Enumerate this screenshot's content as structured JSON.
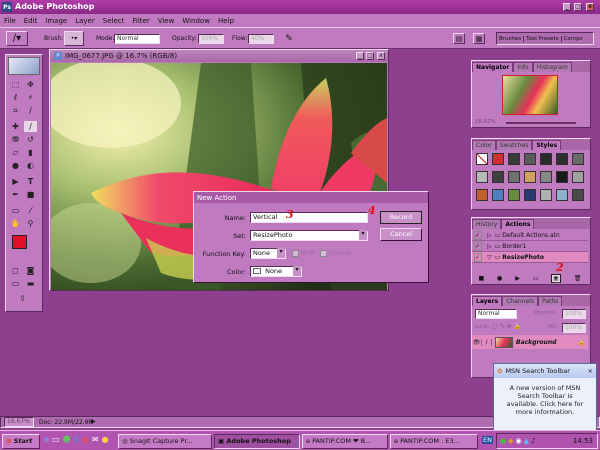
{
  "app": {
    "title": "Adobe Photoshop"
  },
  "menu": [
    "File",
    "Edit",
    "Image",
    "Layer",
    "Select",
    "Filter",
    "View",
    "Window",
    "Help"
  ],
  "options": {
    "brush_label": "Brush:",
    "mode_label": "Mode:",
    "mode_value": "Normal",
    "opacity_label": "Opacity:",
    "opacity_value": "100%",
    "flow_label": "Flow:",
    "flow_value": "40%",
    "well_tabs": [
      "Brushes",
      "Tool Presets",
      "Comps"
    ]
  },
  "document": {
    "title": "IMG_0677.JPG @ 16.7% (RGB/8)"
  },
  "dialog": {
    "title": "New Action",
    "name_label": "Name:",
    "name_value": "Vertical",
    "set_label": "Set:",
    "set_value": "ResizePhoto",
    "fkey_label": "Function Key:",
    "fkey_value": "None",
    "shift_label": "Shift",
    "control_label": "Control",
    "color_label": "Color:",
    "color_value": "None",
    "record_label": "Record",
    "cancel_label": "Cancel"
  },
  "annotations": {
    "n2": "2",
    "n3": "3",
    "n4": "4"
  },
  "navigator": {
    "tabs": [
      "Navigator",
      "Info",
      "Histogram"
    ],
    "zoom": "16.67%"
  },
  "swatches": {
    "tabs": [
      "Color",
      "Swatches",
      "Styles"
    ],
    "colors": [
      "#ffffff",
      "#d23030",
      "#3a3a3a",
      "#5a5a5a",
      "#2a2a2a",
      "#2e2e2e",
      "#6a6a6a",
      "#b8b8b8",
      "#404040",
      "#707070",
      "#d0a060",
      "#888888",
      "#1a1a1a",
      "#a0a0a0",
      "#c06030",
      "#5080c0",
      "#6a8a40",
      "#2a3a70",
      "#b0b0b0",
      "#90b0d0",
      "#4a4a4a"
    ]
  },
  "actions": {
    "tabs": [
      "History",
      "Actions"
    ],
    "items": [
      "Default Actions.atn",
      "Border1",
      "ResizePhoto"
    ]
  },
  "layers": {
    "tabs": [
      "Layers",
      "Channels",
      "Paths"
    ],
    "blend": "Normal",
    "opacity_label": "Opacity:",
    "opacity": "100%",
    "lock_label": "Lock:",
    "fill_label": "Fill:",
    "fill": "100%",
    "layer_name": "Background"
  },
  "status": {
    "zoom": "16.67%",
    "doc": "Doc: 22.9M/22.9M"
  },
  "msn": {
    "title": "MSN Search Toolbar",
    "message": "A new version of MSN Search Toolbar is available. Click here for more information."
  },
  "taskbar": {
    "start": "Start",
    "tasks": [
      "SnagIt Capture Pr...",
      "Adobe Photoshop",
      "PANTIP.COM ❤ B...",
      "PANTIP.COM : E3...",
      "EN"
    ],
    "time": "14:53"
  }
}
